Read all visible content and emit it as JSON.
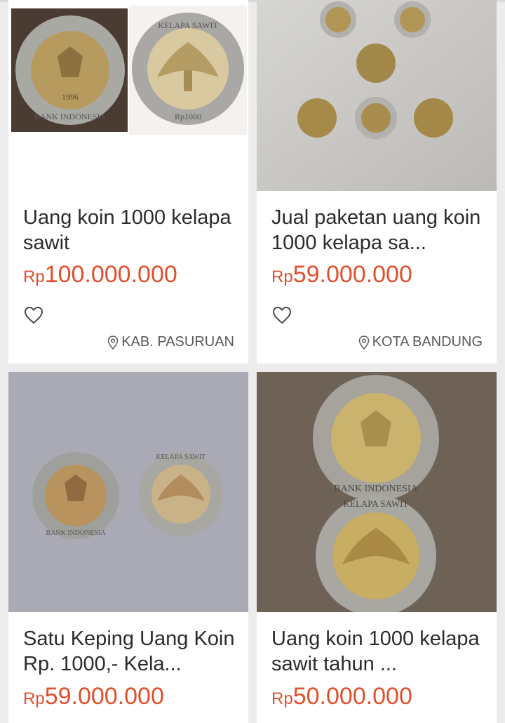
{
  "currency": "Rp",
  "listings": [
    {
      "title": "Uang koin 1000 kelapa sawit",
      "price": "100.000.000",
      "location": "KAB. PASURUAN",
      "image_text": {
        "coin_obverse": "BANK INDONESIA",
        "coin_year": "1996",
        "coin_reverse": "KELAPA SAWIT",
        "coin_value": "Rp1000"
      }
    },
    {
      "title": "Jual paketan uang koin 1000 kelapa sa...",
      "price": "59.000.000",
      "location": "KOTA BANDUNG"
    },
    {
      "title": "Satu Keping Uang Koin Rp. 1000,- Kela...",
      "price": "59.000.000",
      "image_text": {
        "coin_obverse": "BANK INDONESIA",
        "coin_reverse": "KELAPA SAWIT"
      }
    },
    {
      "title": "Uang koin 1000 kelapa sawit tahun ...",
      "price": "50.000.000",
      "image_text": {
        "coin_obverse": "BANK INDONESIA",
        "coin_reverse": "KELAPA SAWIT"
      }
    }
  ],
  "colors": {
    "price": "#e0502c",
    "title": "#2b2b2b",
    "location": "#5a5a5a",
    "background": "#ececec"
  },
  "icons": {
    "favorite": "heart-outline-icon",
    "location": "location-pin-icon"
  }
}
